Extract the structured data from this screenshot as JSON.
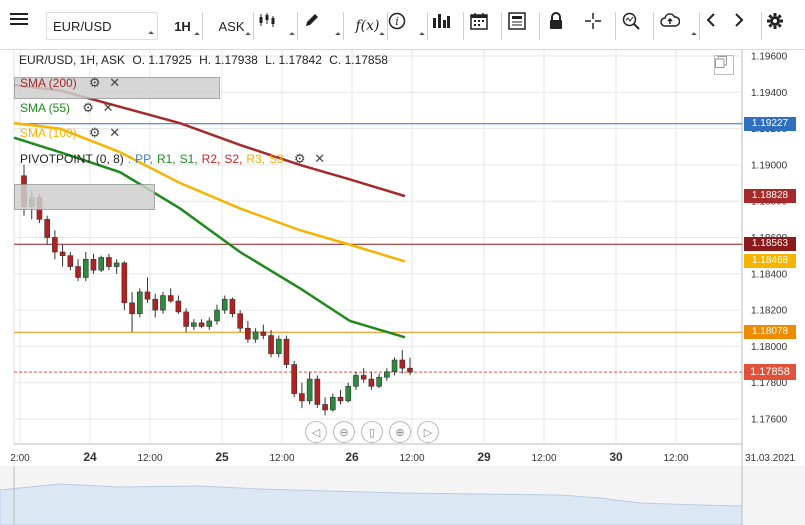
{
  "toolbar": {
    "symbol": "EUR/USD",
    "timeframe": "1H",
    "price_type": "ASK",
    "fx_label": "f(x)",
    "info_label": "i"
  },
  "legend": {
    "instrument": "EUR/USD, 1H, ASK",
    "open": "O. 1.17925",
    "high": "H. 1.17938",
    "low": "L. 1.17842",
    "close": "C. 1.17858"
  },
  "indicators": [
    {
      "label": "SMA (200)",
      "color": "#a52a2a"
    },
    {
      "label": "SMA (55)",
      "color": "#1e8a1e"
    },
    {
      "label": "SMA (100)",
      "color": "#f5b400"
    }
  ],
  "pivot": {
    "label": "PIVOTPOINT (0, 8)",
    "sep": ":",
    "items": [
      {
        "text": "PP,",
        "color": "#3d7fd1"
      },
      {
        "text": "R1,",
        "color": "#1e8a1e"
      },
      {
        "text": "S1,",
        "color": "#1e8a1e"
      },
      {
        "text": "R2,",
        "color": "#cc2222"
      },
      {
        "text": "S2,",
        "color": "#cc2222"
      },
      {
        "text": "R3,",
        "color": "#f5b400"
      },
      {
        "text": "S3",
        "color": "#f5b400"
      }
    ]
  },
  "price_tags": [
    {
      "value": "1.19227",
      "color": "#2f6fc1",
      "price": 1.19227
    },
    {
      "value": "1.18828",
      "color": "#a52a2a",
      "price": 1.18828
    },
    {
      "value": "1.18563",
      "color": "#8b1a1a",
      "price": 1.18563
    },
    {
      "value": "1.18468",
      "color": "#f5b400",
      "price": 1.18468
    },
    {
      "value": "1.18078",
      "color": "#f08a00",
      "price": 1.18078
    },
    {
      "value": "1.17858",
      "color": "#e0533a",
      "price": 1.17858
    }
  ],
  "y_axis": {
    "ticks": [
      "1.19600",
      "1.19400",
      "1.19200",
      "1.19000",
      "1.18800",
      "1.18600",
      "1.18400",
      "1.18200",
      "1.18000",
      "1.17800",
      "1.17600"
    ],
    "values": [
      1.196,
      1.194,
      1.192,
      1.19,
      1.188,
      1.186,
      1.184,
      1.182,
      1.18,
      1.178,
      1.176
    ]
  },
  "x_axis": {
    "labels": [
      {
        "text": "2:00",
        "kind": "minor"
      },
      {
        "text": "24",
        "kind": "major"
      },
      {
        "text": "12:00",
        "kind": "minor"
      },
      {
        "text": "25",
        "kind": "major"
      },
      {
        "text": "12:00",
        "kind": "minor"
      },
      {
        "text": "26",
        "kind": "major"
      },
      {
        "text": "12:00",
        "kind": "minor"
      },
      {
        "text": "29",
        "kind": "major"
      },
      {
        "text": "12:00",
        "kind": "minor"
      },
      {
        "text": "30",
        "kind": "major"
      },
      {
        "text": "12:00",
        "kind": "minor"
      },
      {
        "text": "31.03.2021",
        "kind": "minor"
      }
    ]
  },
  "colors": {
    "up": "#2e8b3e",
    "down": "#b22222",
    "grid": "#e6e6e6",
    "sma200": "#a52a2a",
    "sma55": "#1e8a1e",
    "sma100": "#f5b400"
  }
}
